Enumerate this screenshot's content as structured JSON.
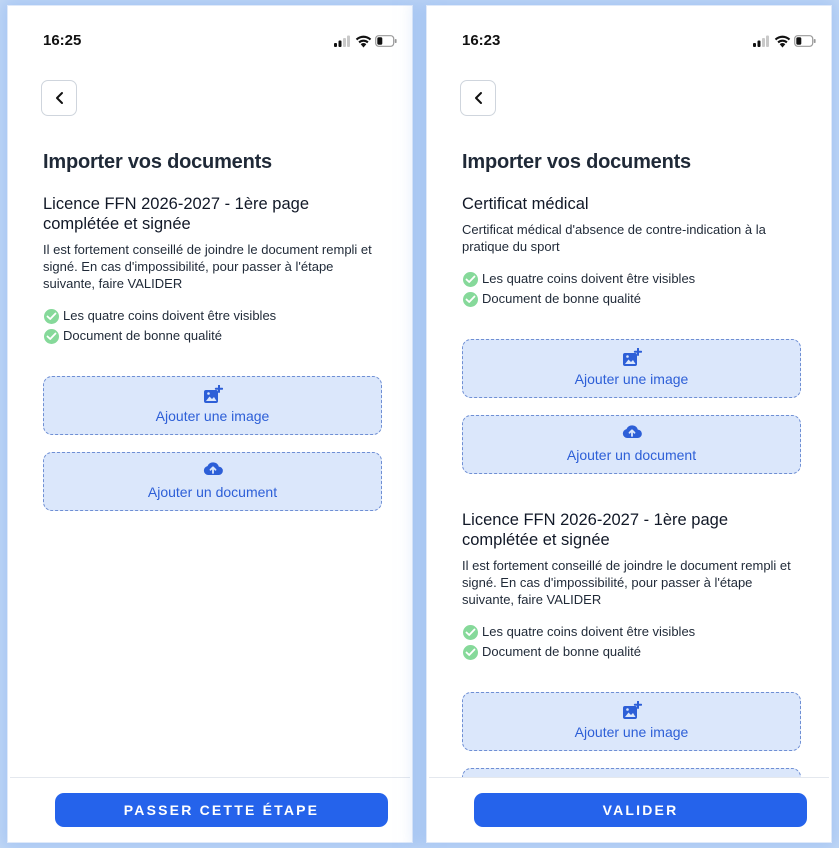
{
  "left": {
    "status": {
      "time": "16:25"
    },
    "page_title": "Importer vos documents",
    "documents": [
      {
        "title": "Licence FFN 2026-2027 - 1ère page complétée et signée",
        "description": "Il est fortement conseillé de joindre le document rempli et signé. En cas d'impossibilité, pour passer à l'étape suivante, faire VALIDER",
        "checks": [
          "Les quatre coins doivent être visibles",
          "Document de bonne qualité"
        ],
        "add_image_label": "Ajouter une image",
        "add_document_label": "Ajouter un document"
      }
    ],
    "footer_button": "PASSER CETTE ÉTAPE"
  },
  "right": {
    "status": {
      "time": "16:23"
    },
    "page_title": "Importer vos documents",
    "documents": [
      {
        "title": "Certificat médical",
        "description": "Certificat médical d'absence de contre-indication à la pratique du sport",
        "checks": [
          "Les quatre coins doivent être visibles",
          "Document de bonne qualité"
        ],
        "add_image_label": "Ajouter une image",
        "add_document_label": "Ajouter un document"
      },
      {
        "title": "Licence FFN 2026-2027 - 1ère page complétée et signée",
        "description": "Il est fortement conseillé de joindre le document rempli et signé. En cas d'impossibilité, pour passer à l'étape suivante, faire VALIDER",
        "checks": [
          "Les quatre coins doivent être visibles",
          "Document de bonne qualité"
        ],
        "add_image_label": "Ajouter une image"
      }
    ],
    "footer_button": "VALIDER"
  },
  "icons": {
    "back": "chevron-left-icon",
    "check": "check-circle-icon",
    "add_image": "add-photo-icon",
    "add_document": "cloud-upload-icon",
    "signal": "signal-icon",
    "wifi": "wifi-icon",
    "battery": "battery-icon"
  },
  "colors": {
    "primary": "#2563eb",
    "upload_bg": "#dbe7fb",
    "upload_border": "#6f8fd4",
    "upload_text": "#2d5fd7",
    "check_green": "#86d99a",
    "page_bg": "#c8dcf6"
  }
}
